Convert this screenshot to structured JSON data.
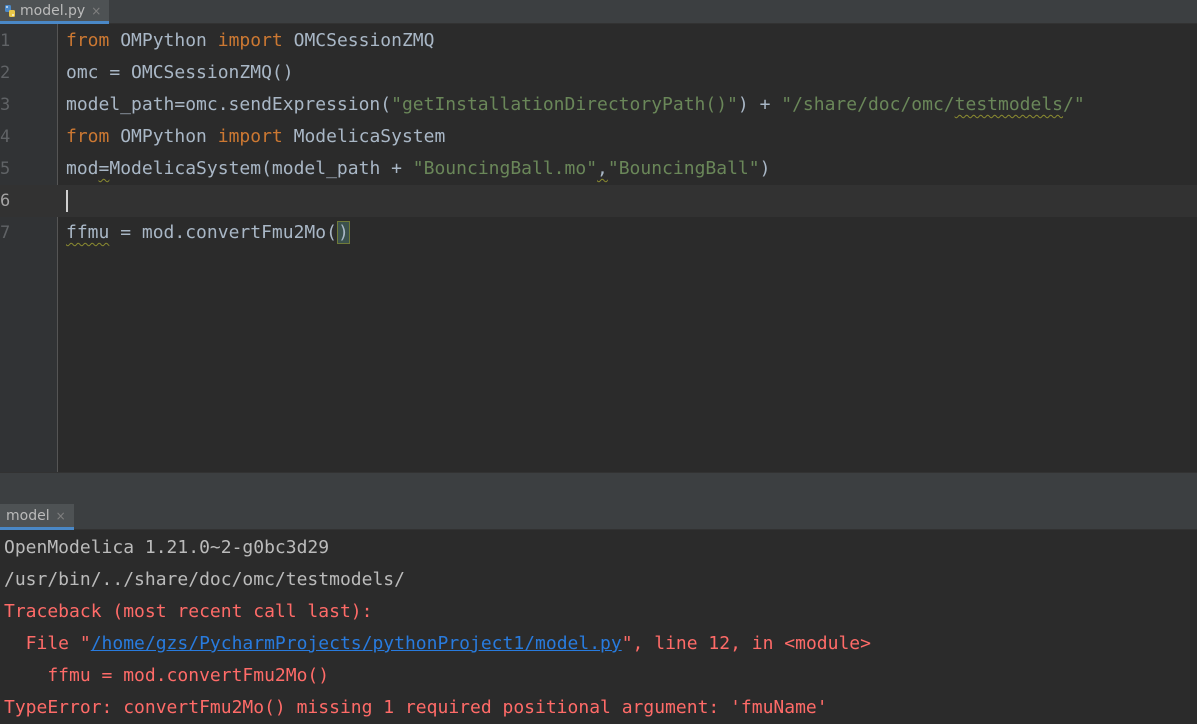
{
  "editor_tab": {
    "label": "model.py",
    "close": "×",
    "icon": "python-file-icon"
  },
  "editor": {
    "line_numbers": [
      "1",
      "2",
      "3",
      "4",
      "5",
      "6",
      "7"
    ],
    "l1": {
      "kw1": "from",
      "mod": " OMPython ",
      "kw2": "import",
      "name": " OMCSessionZMQ"
    },
    "l2": {
      "text": "omc = OMCSessionZMQ()"
    },
    "l3": {
      "pre": "model_path=omc.sendExpression(",
      "str1": "\"getInstallationDirectoryPath()\"",
      "mid": ") + ",
      "str2a": "\"/share/doc/omc/",
      "str2b": "testmodels",
      "str2c": "/\""
    },
    "l4": {
      "kw1": "from",
      "mod": " OMPython ",
      "kw2": "import",
      "name": " ModelicaSystem"
    },
    "l5": {
      "pre": "mod",
      "eq": "=",
      "mid": "ModelicaSystem(model_path + ",
      "str1": "\"BouncingBall.mo\"",
      "comma": ",",
      "str2": "\"BouncingBall\"",
      "post": ")"
    },
    "l7": {
      "var": "ffmu",
      "mid": " = mod.convertFmu2Mo(",
      "close": ")"
    }
  },
  "run_tab": {
    "label": "model",
    "close": "×"
  },
  "console": {
    "line1": "OpenModelica 1.21.0~2-g0bc3d29",
    "line2": "/usr/bin/../share/doc/omc/testmodels/",
    "line3": "Traceback (most recent call last):",
    "line4_pre": "  File \"",
    "line4_link": "/home/gzs/PycharmProjects/pythonProject1/model.py",
    "line4_post": "\", line 12, in <module>",
    "line5": "    ffmu = mod.convertFmu2Mo()",
    "line6": "TypeError: convertFmu2Mo() missing 1 required positional argument: 'fmuName'"
  }
}
